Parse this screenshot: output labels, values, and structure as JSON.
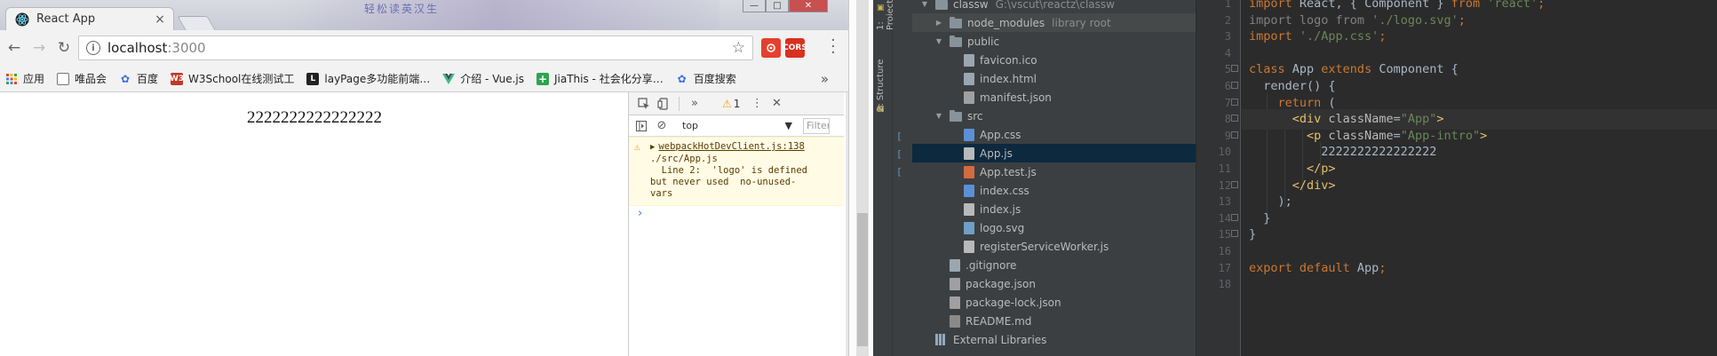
{
  "browser": {
    "tab_title": "React App",
    "tab_close": "×",
    "banner_text": "轻松读英汉生",
    "window_controls": {
      "minimize": "—",
      "maximize": "□",
      "close": "✕"
    },
    "url_host": "localhost",
    "url_port": ":3000",
    "extensions": [
      {
        "label": "",
        "color": "#e5402e"
      },
      {
        "label": "CORS",
        "color": "#d9301f"
      }
    ],
    "bookmarks": [
      {
        "label": "应用",
        "icon": "apps-icon",
        "color": "#ea4335"
      },
      {
        "label": "唯品会",
        "icon": "page-icon",
        "color": "#ffffff"
      },
      {
        "label": "百度",
        "icon": "paw-icon",
        "color": "#3a6fe0"
      },
      {
        "label": "W3School在线测试工",
        "icon": "w3-icon",
        "color": "#c0392b"
      },
      {
        "label": "layPage多功能前端…",
        "icon": "layui-icon",
        "color": "#222222"
      },
      {
        "label": "介绍 - Vue.js",
        "icon": "vue-icon",
        "color": "#41b883"
      },
      {
        "label": "JiaThis - 社会化分享…",
        "icon": "plus-icon",
        "color": "#2ea44f"
      },
      {
        "label": "百度搜索",
        "icon": "paw-icon",
        "color": "#3a6fe0"
      }
    ],
    "bookmarks_more": "»",
    "page_text": "2222222222222222"
  },
  "devtools": {
    "more_tabs": "»",
    "warning_count": "1",
    "context": "top",
    "filter_placeholder": "Filter",
    "message": {
      "source": "webpackHotDevClient.js:138",
      "lines": [
        "./src/App.js",
        "  Line 2:  'logo' is defined",
        "but never used  no-unused-",
        "vars"
      ]
    },
    "prompt": "›"
  },
  "ide": {
    "side_labels": [
      "1: Project",
      "2: Structure"
    ],
    "tree": [
      {
        "label": "classw",
        "hint": "G:\\vscut\\reactz\\classw",
        "depth": 0,
        "type": "folder",
        "arrow": "▼",
        "state": ""
      },
      {
        "label": "node_modules",
        "hint": "library root",
        "depth": 1,
        "type": "folder",
        "arrow": "▶",
        "state": "highlight"
      },
      {
        "label": "public",
        "hint": "",
        "depth": 1,
        "type": "folder",
        "arrow": "▼",
        "state": ""
      },
      {
        "label": "favicon.ico",
        "hint": "",
        "depth": 2,
        "type": "file",
        "kind": "",
        "state": ""
      },
      {
        "label": "index.html",
        "hint": "",
        "depth": 2,
        "type": "file",
        "kind": "",
        "state": ""
      },
      {
        "label": "manifest.json",
        "hint": "",
        "depth": 2,
        "type": "file",
        "kind": "json",
        "state": ""
      },
      {
        "label": "src",
        "hint": "",
        "depth": 1,
        "type": "folder",
        "arrow": "▼",
        "state": ""
      },
      {
        "label": "App.css",
        "hint": "",
        "depth": 2,
        "type": "file",
        "kind": "css",
        "state": ""
      },
      {
        "label": "App.js",
        "hint": "",
        "depth": 2,
        "type": "file",
        "kind": "js",
        "state": "selected"
      },
      {
        "label": "App.test.js",
        "hint": "",
        "depth": 2,
        "type": "file",
        "kind": "test",
        "state": ""
      },
      {
        "label": "index.css",
        "hint": "",
        "depth": 2,
        "type": "file",
        "kind": "css",
        "state": ""
      },
      {
        "label": "index.js",
        "hint": "",
        "depth": 2,
        "type": "file",
        "kind": "js",
        "state": ""
      },
      {
        "label": "logo.svg",
        "hint": "",
        "depth": 2,
        "type": "file",
        "kind": "svg",
        "state": ""
      },
      {
        "label": "registerServiceWorker.js",
        "hint": "",
        "depth": 2,
        "type": "file",
        "kind": "js",
        "state": ""
      },
      {
        "label": ".gitignore",
        "hint": "",
        "depth": 1,
        "type": "file",
        "kind": "",
        "state": ""
      },
      {
        "label": "package.json",
        "hint": "",
        "depth": 1,
        "type": "file",
        "kind": "json",
        "state": ""
      },
      {
        "label": "package-lock.json",
        "hint": "",
        "depth": 1,
        "type": "file",
        "kind": "json",
        "state": ""
      },
      {
        "label": "README.md",
        "hint": "",
        "depth": 1,
        "type": "file",
        "kind": "md",
        "state": ""
      },
      {
        "label": "External Libraries",
        "hint": "",
        "depth": 0,
        "type": "library",
        "state": ""
      }
    ],
    "line_numbers": [
      "1",
      "2",
      "3",
      "4",
      "5",
      "6",
      "7",
      "8",
      "9",
      "10",
      "11",
      "12",
      "13",
      "14",
      "15",
      "16",
      "17",
      "18"
    ],
    "code": [
      [
        [
          "kw",
          "import "
        ],
        [
          "id",
          "React, { "
        ],
        [
          "id",
          "Component"
        ],
        [
          "id",
          " } "
        ],
        [
          "kw",
          "from "
        ],
        [
          "str",
          "'react'"
        ],
        [
          "kw",
          ";"
        ]
      ],
      [
        [
          "dim",
          "import "
        ],
        [
          "dim",
          "logo "
        ],
        [
          "dim",
          "from "
        ],
        [
          "str",
          "'./logo.svg'"
        ],
        [
          "kw",
          ";"
        ]
      ],
      [
        [
          "kw",
          "import "
        ],
        [
          "str",
          "'./App.css'"
        ],
        [
          "kw",
          ";"
        ]
      ],
      [],
      [
        [
          "kw",
          "class "
        ],
        [
          "id",
          "App "
        ],
        [
          "kw",
          "extends "
        ],
        [
          "id",
          "Component {"
        ]
      ],
      [
        [
          "id",
          "  render() {"
        ]
      ],
      [
        [
          "kw",
          "    return "
        ],
        [
          "id",
          "("
        ]
      ],
      [
        [
          "id",
          "      "
        ],
        [
          "tag",
          "<div "
        ],
        [
          "attr",
          "className"
        ],
        [
          "id",
          "="
        ],
        [
          "str",
          "\"App\""
        ],
        [
          "tag",
          ">"
        ]
      ],
      [
        [
          "id",
          "        "
        ],
        [
          "tag",
          "<p "
        ],
        [
          "attr",
          "className"
        ],
        [
          "id",
          "="
        ],
        [
          "str",
          "\"App-intro\""
        ],
        [
          "tag",
          ">"
        ]
      ],
      [
        [
          "id",
          "          2222222222222222"
        ]
      ],
      [
        [
          "id",
          "        "
        ],
        [
          "tag",
          "</p>"
        ]
      ],
      [
        [
          "id",
          "      "
        ],
        [
          "tag",
          "</div>"
        ]
      ],
      [
        [
          "id",
          "    );"
        ]
      ],
      [
        [
          "id",
          "  }"
        ]
      ],
      [
        [
          "id",
          "}"
        ]
      ],
      [],
      [
        [
          "kw",
          "export default "
        ],
        [
          "id",
          "App"
        ],
        [
          "kw",
          ";"
        ]
      ],
      []
    ]
  }
}
